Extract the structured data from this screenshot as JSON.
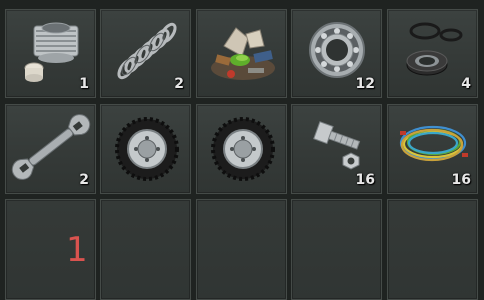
{
  "inventory": {
    "slots": [
      {
        "item_icon": "engine-cylinder-icon",
        "count": "1"
      },
      {
        "item_icon": "spring-icon",
        "count": "2"
      },
      {
        "item_icon": "scrap-pile-icon",
        "count": ""
      },
      {
        "item_icon": "bearing-icon",
        "count": "12"
      },
      {
        "item_icon": "seal-rings-icon",
        "count": "4"
      },
      {
        "item_icon": "wrench-icon",
        "count": "2"
      },
      {
        "item_icon": "wheel-icon",
        "count": ""
      },
      {
        "item_icon": "wheel-icon",
        "count": ""
      },
      {
        "item_icon": "bolt-nut-icon",
        "count": "16"
      },
      {
        "item_icon": "wires-icon",
        "count": "16"
      },
      {
        "item_icon": "",
        "count": ""
      },
      {
        "item_icon": "",
        "count": ""
      },
      {
        "item_icon": "",
        "count": ""
      },
      {
        "item_icon": "",
        "count": ""
      },
      {
        "item_icon": "",
        "count": ""
      }
    ],
    "page_number": "1",
    "colors": {
      "page_number": "#d9534f",
      "slot_bg": "#3a3f3d",
      "count_text": "#e8e8e8"
    }
  }
}
